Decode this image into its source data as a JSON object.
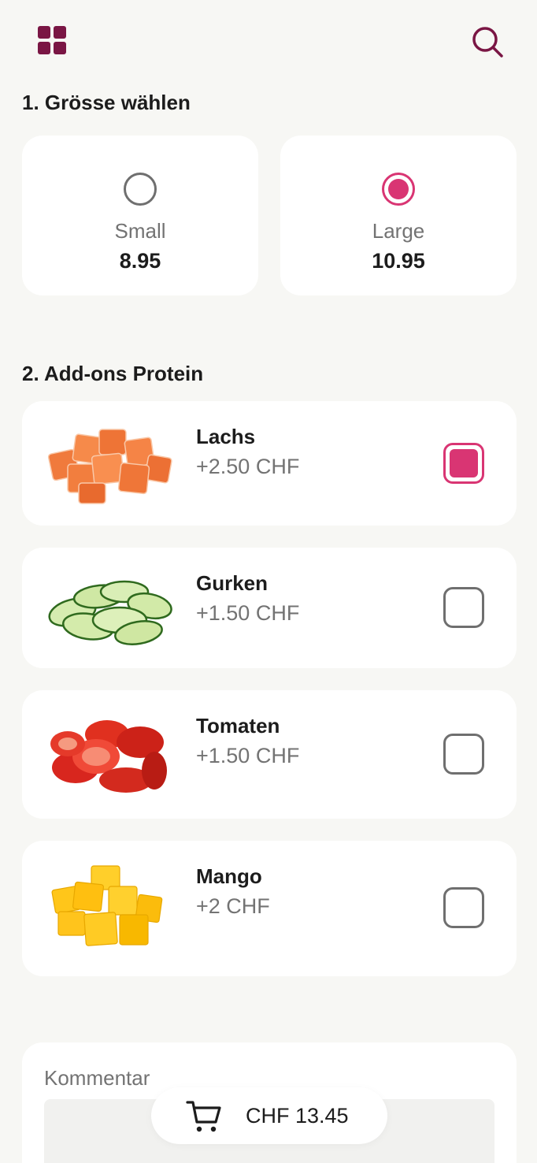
{
  "header": {
    "menu_icon": "grid-icon",
    "search_icon": "search-icon",
    "accent_color": "#7a1644"
  },
  "size_section": {
    "title": "1. Grösse wählen",
    "options": [
      {
        "name": "Small",
        "price": "8.95",
        "selected": false
      },
      {
        "name": "Large",
        "price": "10.95",
        "selected": true
      }
    ]
  },
  "addons_section": {
    "title": "2. Add-ons Protein",
    "items": [
      {
        "name": "Lachs",
        "price": "+2.50 CHF",
        "checked": true,
        "image": "salmon-cubes"
      },
      {
        "name": "Gurken",
        "price": "+1.50 CHF",
        "checked": false,
        "image": "cucumber-slices"
      },
      {
        "name": "Tomaten",
        "price": "+1.50 CHF",
        "checked": false,
        "image": "cherry-tomatoes"
      },
      {
        "name": "Mango",
        "price": "+2 CHF",
        "checked": false,
        "image": "mango-cubes"
      }
    ]
  },
  "comment": {
    "label": "Kommentar"
  },
  "cart": {
    "icon": "cart-icon",
    "total": "CHF 13.45"
  },
  "colors": {
    "selected": "#d93573",
    "background": "#f7f7f4",
    "card": "#ffffff"
  }
}
